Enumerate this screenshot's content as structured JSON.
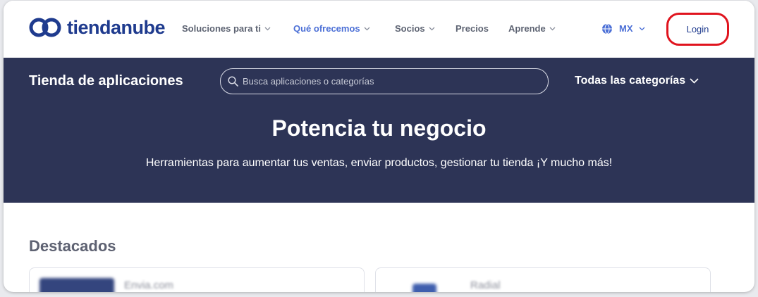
{
  "brand": {
    "name": "tiendanube",
    "color": "#1f3b8e"
  },
  "nav": {
    "items": [
      {
        "label": "Soluciones para ti",
        "has_dropdown": true,
        "active": false
      },
      {
        "label": "Qué ofrecemos",
        "has_dropdown": true,
        "active": true
      },
      {
        "label": "Socios",
        "has_dropdown": true,
        "active": false
      },
      {
        "label": "Precios",
        "has_dropdown": false,
        "active": false
      },
      {
        "label": "Aprende",
        "has_dropdown": true,
        "active": false
      }
    ],
    "region": "MX",
    "login_label": "Login"
  },
  "banner": {
    "store_title": "Tienda de aplicaciones",
    "search_placeholder": "Busca aplicaciones o categorías",
    "categories_label": "Todas las categorías",
    "hero_title": "Potencia tu negocio",
    "hero_subtitle": "Herramientas para aumentar tus ventas, enviar productos, gestionar tu tienda ¡Y mucho más!",
    "bg_color": "#2d3456"
  },
  "featured": {
    "title": "Destacados",
    "cards": [
      {
        "name": "Envia.com"
      },
      {
        "name": "Radial"
      }
    ]
  },
  "colors": {
    "accent": "#4b6fd6",
    "highlight": "#e0141e"
  },
  "icons": [
    "tiendanube-logo-icon",
    "chevron-down-icon",
    "globe-icon",
    "search-icon"
  ]
}
